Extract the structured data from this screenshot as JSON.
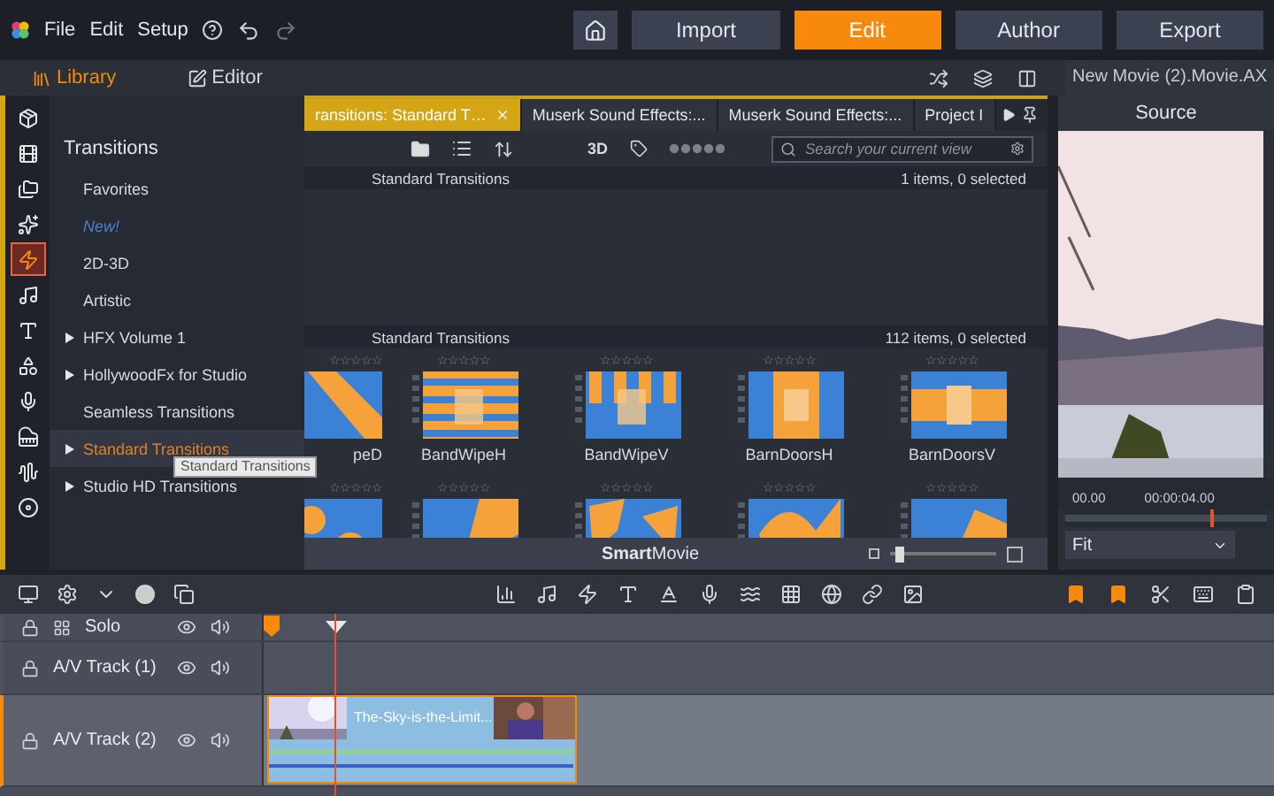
{
  "menu": [
    "File",
    "Edit",
    "Setup"
  ],
  "modes": [
    {
      "label": "Import",
      "selected": false
    },
    {
      "label": "Edit",
      "selected": true
    },
    {
      "label": "Author",
      "selected": false
    },
    {
      "label": "Export",
      "selected": false
    }
  ],
  "panel_tabs": [
    {
      "label": "Library",
      "kind": "library",
      "selected": true
    },
    {
      "label": "Editor",
      "kind": "editor",
      "selected": false
    }
  ],
  "movie_title": "New Movie (2).Movie.AX",
  "rail": [
    {
      "kind": "package",
      "selected": false
    },
    {
      "kind": "film",
      "selected": false
    },
    {
      "kind": "folders",
      "selected": false
    },
    {
      "kind": "effects",
      "selected": false
    },
    {
      "kind": "transitions",
      "selected": true
    },
    {
      "kind": "music",
      "selected": false
    },
    {
      "kind": "title",
      "selected": false
    },
    {
      "kind": "overlay",
      "selected": false
    },
    {
      "kind": "sound",
      "selected": false
    },
    {
      "kind": "piano",
      "selected": false
    },
    {
      "kind": "wave",
      "selected": false
    },
    {
      "kind": "disc",
      "selected": false
    }
  ],
  "categories": {
    "title": "Transitions",
    "items": [
      {
        "label": "Favorites",
        "kind": "plain",
        "expandable": false,
        "selected": false
      },
      {
        "label": "New!",
        "kind": "new",
        "expandable": false,
        "selected": false
      },
      {
        "label": "2D-3D",
        "kind": "plain",
        "expandable": false,
        "selected": false
      },
      {
        "label": "Artistic",
        "kind": "plain",
        "expandable": false,
        "selected": false
      },
      {
        "label": "HFX Volume 1",
        "kind": "plain",
        "expandable": true,
        "selected": false
      },
      {
        "label": "HollywoodFx for Studio",
        "kind": "plain",
        "expandable": true,
        "selected": false
      },
      {
        "label": "Seamless Transitions",
        "kind": "plain",
        "expandable": false,
        "selected": false
      },
      {
        "label": "Standard Transitions",
        "kind": "plain",
        "expandable": true,
        "selected": true
      },
      {
        "label": "Studio HD Transitions",
        "kind": "plain",
        "expandable": true,
        "selected": false
      }
    ]
  },
  "tooltip": "Standard Transitions",
  "library_tabs": [
    {
      "label": "ransitions: Standard T…",
      "selected": true
    },
    {
      "label": "Muserk Sound Effects:...",
      "selected": false
    },
    {
      "label": "Muserk Sound Effects:...",
      "selected": false
    },
    {
      "label": "Project I",
      "selected": false
    }
  ],
  "toolbar": {
    "view_3d": "3D"
  },
  "search": {
    "placeholder": "Search your current view"
  },
  "sections": [
    {
      "title": "Standard Transitions",
      "count": "1 items, 0 selected"
    },
    {
      "title": "Standard Transitions",
      "count": "112 items, 0 selected",
      "items": [
        {
          "label": "peD",
          "kind": "diag",
          "stars": 0
        },
        {
          "label": "BandWipeH",
          "kind": "bands_h",
          "stars": 0
        },
        {
          "label": "BandWipeV",
          "kind": "bands_v",
          "stars": 0
        },
        {
          "label": "BarnDoorsH",
          "kind": "doors_h",
          "stars": 0
        },
        {
          "label": "BarnDoorsV",
          "kind": "doors_v",
          "stars": 0
        },
        {
          "kind": "splash",
          "stars": 0
        },
        {
          "kind": "dots",
          "stars": 0
        },
        {
          "kind": "shards",
          "stars": 0
        },
        {
          "kind": "curve",
          "stars": 0
        },
        {
          "kind": "patch",
          "stars": 0
        }
      ]
    }
  ],
  "smartmovie": "**Smart**Movie",
  "zoom": {
    "level": 0.05
  },
  "preview": {
    "title": "Source",
    "timecodes": [
      "00.00",
      "00:00:04.00"
    ],
    "level": 0.72,
    "fit": "Fit"
  },
  "tracks": [
    {
      "name": "Solo",
      "kind": "solo",
      "selected": false
    },
    {
      "name": "A/V Track (1)",
      "kind": "track",
      "selected": false
    },
    {
      "name": "A/V Track (2)",
      "kind": "track",
      "selected": true,
      "clips": [
        {
          "title": "The-Sky-is-the-Limit..."
        }
      ]
    }
  ]
}
